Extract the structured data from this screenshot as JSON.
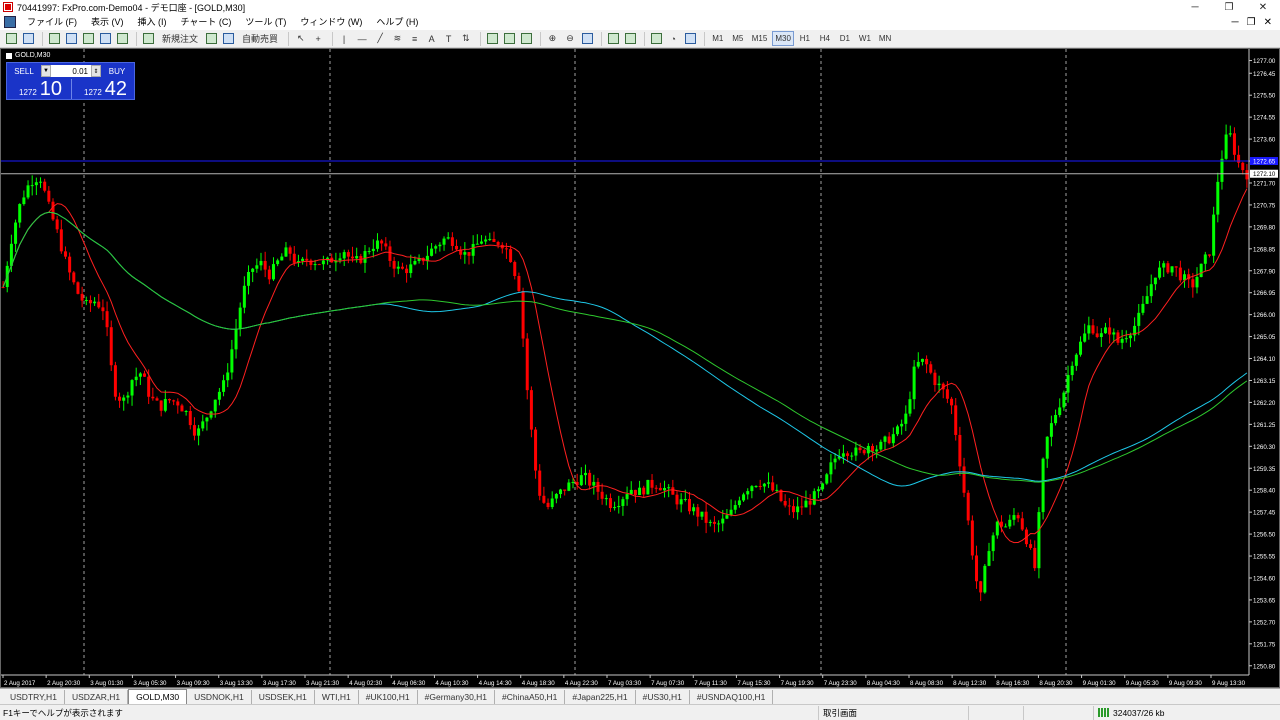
{
  "window": {
    "title": "70441997: FxPro.com-Demo04 - デモ口座 - [GOLD,M30]",
    "minimize": "─",
    "maximize": "❐",
    "close": "✕"
  },
  "menu": {
    "items": [
      "ファイル (F)",
      "表示 (V)",
      "挿入 (I)",
      "チャート (C)",
      "ツール (T)",
      "ウィンドウ (W)",
      "ヘルプ (H)"
    ],
    "mdi_controls": [
      "─",
      "❐",
      "✕"
    ]
  },
  "toolbar": {
    "new_order_label": "新規注文",
    "auto_trading_label": "自動売買",
    "timeframes": [
      "M1",
      "M5",
      "M15",
      "M30",
      "H1",
      "H4",
      "D1",
      "W1",
      "MN"
    ],
    "active_timeframe": "M30"
  },
  "chart": {
    "symbol_label": "GOLD,M30",
    "price_labels": [
      "1277.00",
      "1276.45",
      "1275.50",
      "1274.55",
      "1273.60",
      "1272.65",
      "1271.70",
      "1270.75",
      "1269.80",
      "1268.85",
      "1267.90",
      "1266.95",
      "1266.00",
      "1265.05",
      "1264.10",
      "1263.15",
      "1262.20",
      "1261.25",
      "1260.30",
      "1259.35",
      "1258.40",
      "1257.45",
      "1256.50",
      "1255.55",
      "1254.60",
      "1253.65",
      "1252.70",
      "1251.75",
      "1250.80"
    ],
    "time_labels": [
      "2 Aug 2017",
      "2 Aug 20:30",
      "3 Aug 01:30",
      "3 Aug 05:30",
      "3 Aug 09:30",
      "3 Aug 13:30",
      "3 Aug 17:30",
      "3 Aug 21:30",
      "4 Aug 02:30",
      "4 Aug 06:30",
      "4 Aug 10:30",
      "4 Aug 14:30",
      "4 Aug 18:30",
      "4 Aug 22:30",
      "7 Aug 03:30",
      "7 Aug 07:30",
      "7 Aug 11:30",
      "7 Aug 15:30",
      "7 Aug 19:30",
      "7 Aug 23:30",
      "8 Aug 04:30",
      "8 Aug 08:30",
      "8 Aug 12:30",
      "8 Aug 16:30",
      "8 Aug 20:30",
      "9 Aug 01:30",
      "9 Aug 05:30",
      "9 Aug 09:30",
      "9 Aug 13:30"
    ],
    "bid_label": "1272.10",
    "ask_label": "1272.65",
    "bid_price": 1272.1,
    "ask_price": 1272.65,
    "y_min": 1250.4,
    "y_max": 1277.5,
    "colors": {
      "up": "#00ff00",
      "down": "#ff0000",
      "ma_fast": "#ff2020",
      "ma_slow1": "#1ec8e8",
      "ma_slow2": "#2ec82e",
      "bid_line": "#b4b4b4",
      "ask_line": "#1a1aff",
      "grid": "#a0a0a0"
    }
  },
  "trade_panel": {
    "sell_label": "SELL",
    "buy_label": "BUY",
    "lot": "0.01",
    "lot_arrow": "▼",
    "bid_small": "1272",
    "bid_big": "10",
    "ask_small": "1272",
    "ask_big": "42"
  },
  "chart_data": {
    "type": "candlestick",
    "x_labels": [
      "2 Aug 2017",
      "2 Aug 20:30",
      "3 Aug 01:30",
      "3 Aug 05:30",
      "3 Aug 09:30",
      "3 Aug 13:30",
      "3 Aug 17:30",
      "3 Aug 21:30",
      "4 Aug 02:30",
      "4 Aug 06:30",
      "4 Aug 10:30",
      "4 Aug 14:30",
      "4 Aug 18:30",
      "4 Aug 22:30",
      "7 Aug 03:30",
      "7 Aug 07:30",
      "7 Aug 11:30",
      "7 Aug 15:30",
      "7 Aug 19:30",
      "7 Aug 23:30",
      "8 Aug 04:30",
      "8 Aug 08:30",
      "8 Aug 12:30",
      "8 Aug 16:30",
      "8 Aug 20:30",
      "9 Aug 01:30",
      "9 Aug 05:30",
      "9 Aug 09:30",
      "9 Aug 13:30"
    ],
    "close_path": [
      1267.2,
      1269.5,
      1271.0,
      1271.8,
      1272.0,
      1270.6,
      1269.4,
      1268.0,
      1267.0,
      1266.4,
      1266.6,
      1266.2,
      1262.8,
      1262.2,
      1263.2,
      1263.5,
      1262.4,
      1262.0,
      1262.3,
      1262.2,
      1261.7,
      1260.8,
      1261.5,
      1262.4,
      1263.0,
      1264.8,
      1266.9,
      1268.0,
      1268.2,
      1267.7,
      1268.4,
      1268.8,
      1268.1,
      1268.4,
      1268.3,
      1268.2,
      1268.5,
      1268.8,
      1268.2,
      1268.5,
      1269.0,
      1269.1,
      1268.4,
      1267.9,
      1268.0,
      1268.2,
      1268.6,
      1269.0,
      1269.3,
      1269.2,
      1268.6,
      1268.8,
      1269.3,
      1269.0,
      1269.2,
      1268.6,
      1267.2,
      1262.2,
      1258.5,
      1257.6,
      1258.1,
      1258.5,
      1258.8,
      1259.0,
      1258.6,
      1258.2,
      1257.8,
      1258.0,
      1258.5,
      1258.3,
      1258.6,
      1258.7,
      1258.4,
      1258.0,
      1257.8,
      1257.5,
      1257.2,
      1256.8,
      1257.0,
      1257.4,
      1258.2,
      1258.6,
      1258.8,
      1258.6,
      1258.2,
      1257.6,
      1257.5,
      1257.8,
      1258.1,
      1258.5,
      1259.6,
      1260.2,
      1260.1,
      1260.0,
      1260.4,
      1260.2,
      1260.6,
      1260.9,
      1261.6,
      1263.8,
      1264.0,
      1263.2,
      1262.7,
      1262.0,
      1259.2,
      1256.3,
      1253.5,
      1256.0,
      1257.0,
      1256.8,
      1257.5,
      1256.4,
      1255.0,
      1260.2,
      1261.5,
      1262.5,
      1264.0,
      1264.8,
      1265.6,
      1265.0,
      1265.4,
      1264.8,
      1265.2,
      1265.6,
      1266.6,
      1267.8,
      1268.0,
      1268.1,
      1267.6,
      1267.2,
      1268.0,
      1268.8,
      1272.4,
      1274.0,
      1272.6,
      1272.1
    ],
    "ma_fast_end": 1269.9,
    "ma_slow_end": 1262.8,
    "ylim": [
      1250.4,
      1277.5
    ]
  },
  "tabs": [
    "USDTRY,H1",
    "USDZAR,H1",
    "GOLD,M30",
    "USDNOK,H1",
    "USDSEK,H1",
    "WTI,H1",
    "#UK100,H1",
    "#Germany30,H1",
    "#ChinaA50,H1",
    "#Japan225,H1",
    "#US30,H1",
    "#USNDAQ100,H1"
  ],
  "active_tab": "GOLD,M30",
  "status": {
    "help": "F1キーでヘルプが表示されます",
    "profile": "取引画面",
    "traffic": "324037/26 kb"
  }
}
